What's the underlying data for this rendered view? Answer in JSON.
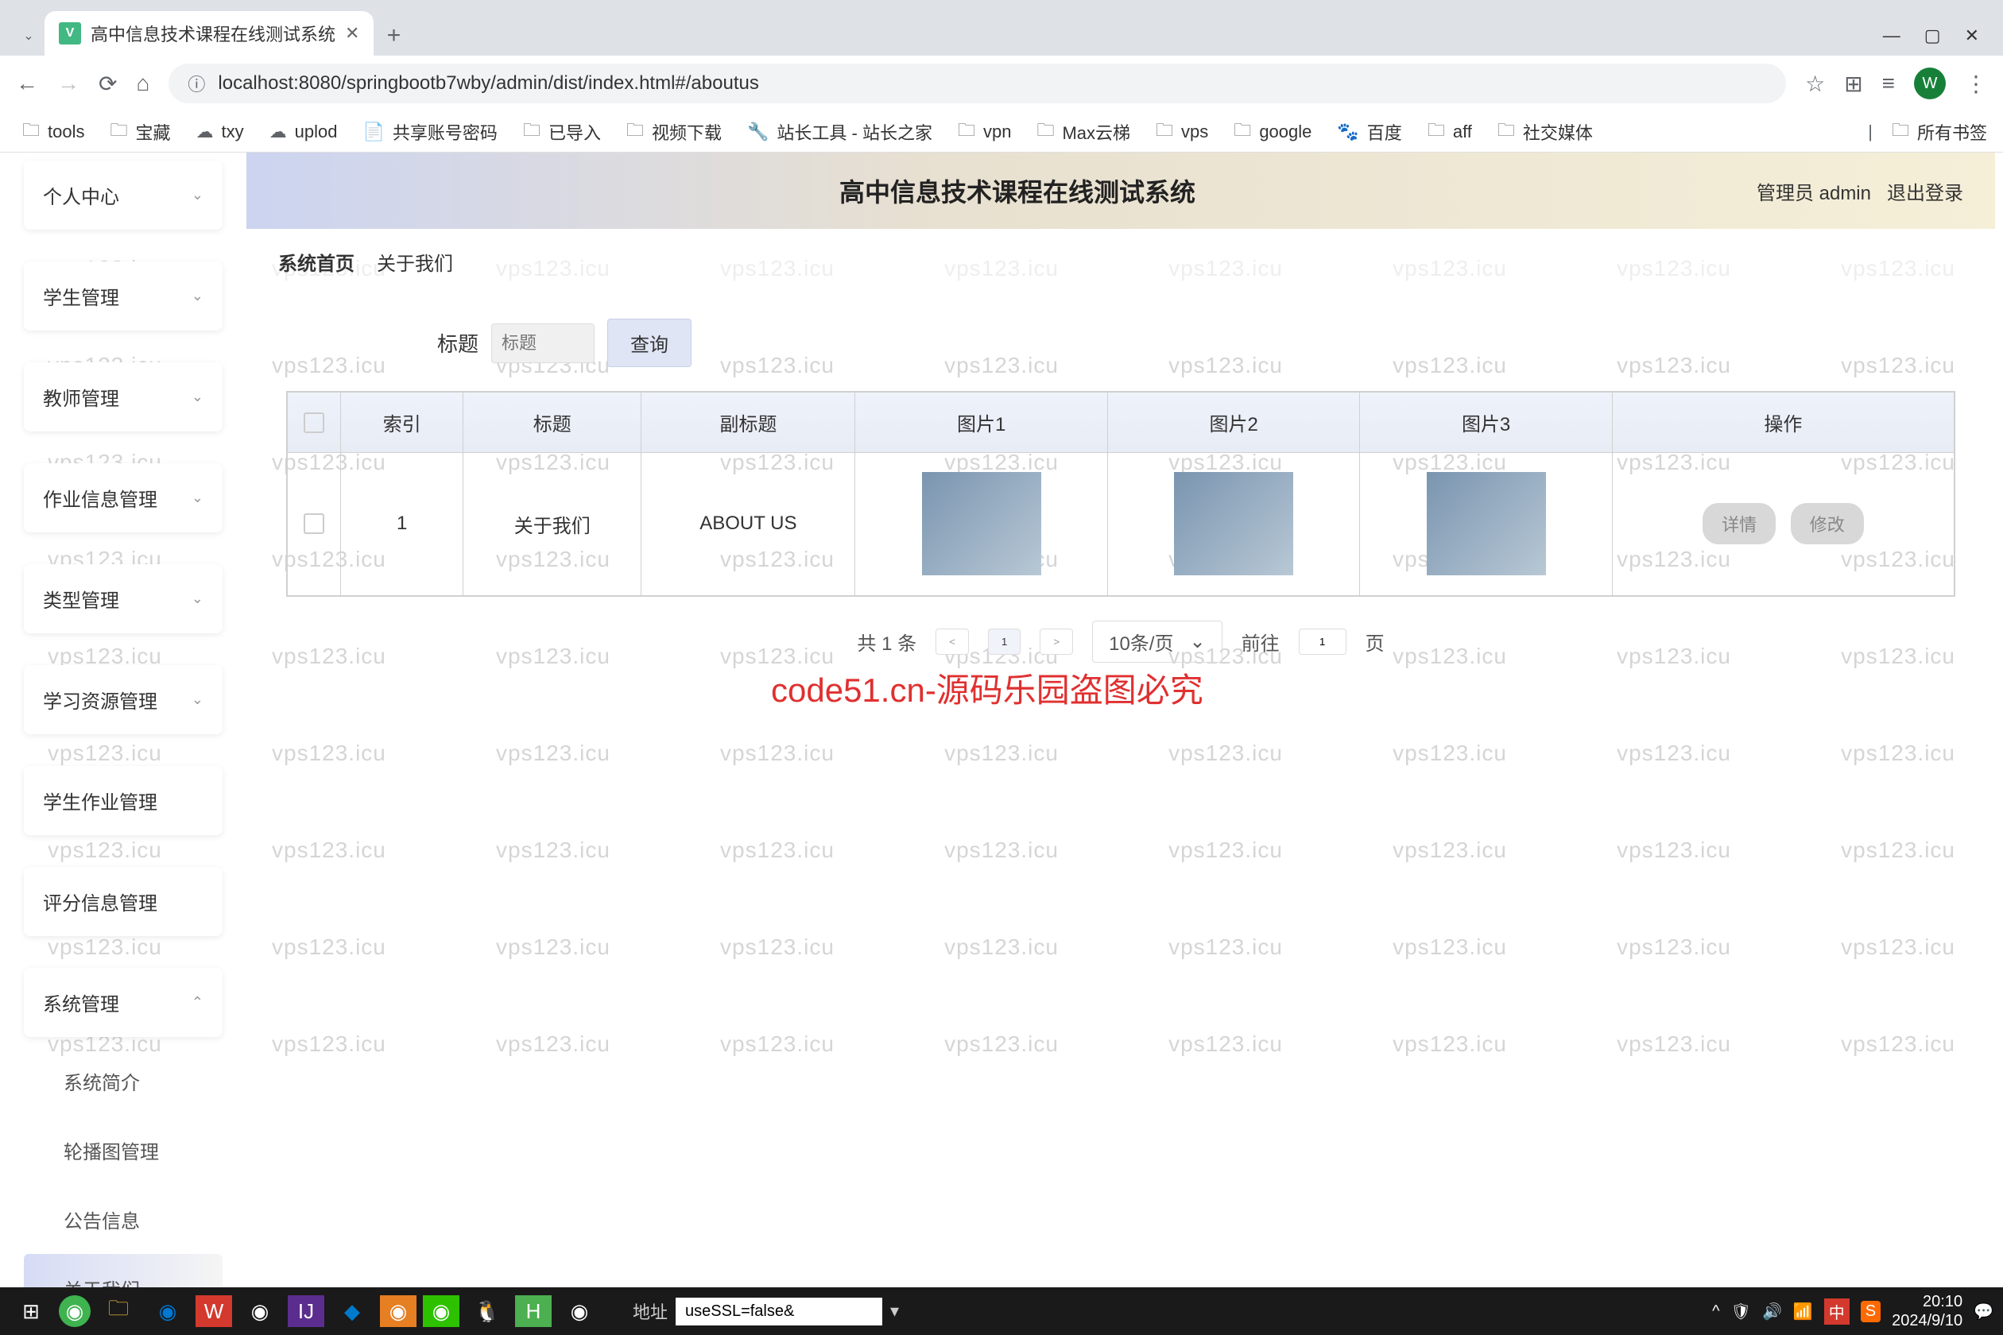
{
  "browser": {
    "tab_title": "高中信息技术课程在线测试系统",
    "url": "localhost:8080/springbootb7wby/admin/dist/index.html#/aboutus",
    "avatar": "W"
  },
  "bookmarks": {
    "items": [
      "tools",
      "宝藏",
      "txy",
      "uplod",
      "共享账号密码",
      "已导入",
      "视频下载",
      "站长工具 - 站长之家",
      "vpn",
      "Max云梯",
      "vps",
      "google",
      "百度",
      "aff",
      "社交媒体"
    ],
    "right": "所有书签"
  },
  "sidebar": {
    "items": [
      {
        "label": "个人中心",
        "expandable": true
      },
      {
        "label": "学生管理",
        "expandable": true
      },
      {
        "label": "教师管理",
        "expandable": true
      },
      {
        "label": "作业信息管理",
        "expandable": true
      },
      {
        "label": "类型管理",
        "expandable": true
      },
      {
        "label": "学习资源管理",
        "expandable": true
      },
      {
        "label": "学生作业管理",
        "expandable": false
      },
      {
        "label": "评分信息管理",
        "expandable": false
      },
      {
        "label": "系统管理",
        "expandable": true,
        "expanded": true
      }
    ],
    "submenu": [
      "系统简介",
      "轮播图管理",
      "公告信息",
      "关于我们"
    ],
    "submenu_active": "关于我们"
  },
  "header": {
    "title": "高中信息技术课程在线测试系统",
    "user": "管理员 admin",
    "logout": "退出登录"
  },
  "breadcrumb": {
    "home": "系统首页",
    "current": "关于我们"
  },
  "search": {
    "label": "标题",
    "placeholder": "标题",
    "button": "查询"
  },
  "table": {
    "columns": [
      "索引",
      "标题",
      "副标题",
      "图片1",
      "图片2",
      "图片3",
      "操作"
    ],
    "rows": [
      {
        "index": "1",
        "title": "关于我们",
        "subtitle": "ABOUT US"
      }
    ],
    "actions": {
      "detail": "详情",
      "edit": "修改"
    }
  },
  "pagination": {
    "total": "共 1 条",
    "prev": "<",
    "current": "1",
    "next": ">",
    "page_size": "10条/页",
    "goto_prefix": "前往",
    "goto_value": "1",
    "goto_suffix": "页"
  },
  "watermark": {
    "text": "vps123.icu",
    "red_text": "code51.cn-源码乐园盗图必究"
  },
  "taskbar": {
    "address_label": "地址",
    "address_value": "useSSL=false&",
    "time": "20:10",
    "date": "2024/9/10",
    "ime": "中"
  }
}
